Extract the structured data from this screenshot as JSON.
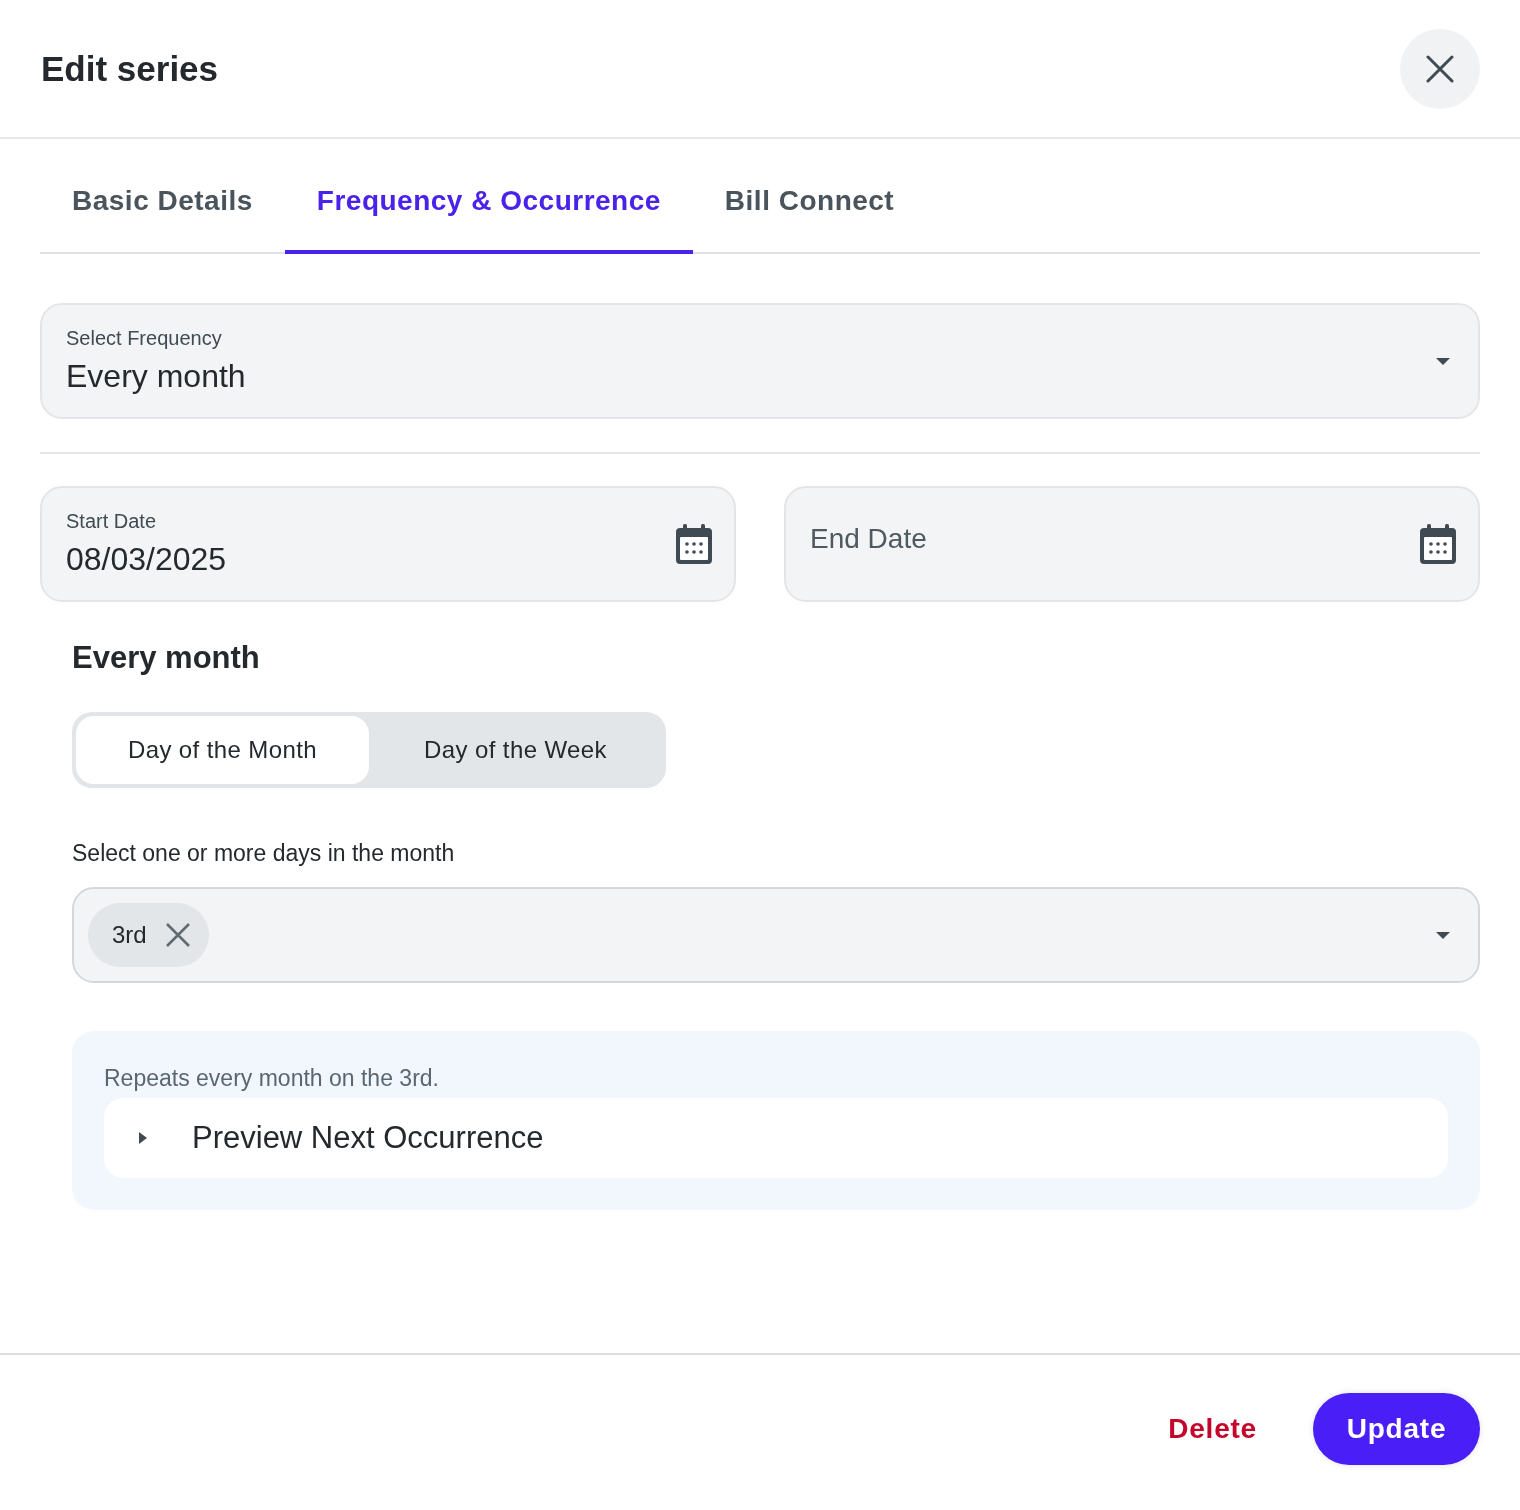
{
  "dialog": {
    "title": "Edit series"
  },
  "tabs": [
    {
      "label": "Basic Details",
      "selected": false
    },
    {
      "label": "Frequency & Occurrence",
      "selected": true
    },
    {
      "label": "Bill Connect",
      "selected": false
    }
  ],
  "frequency": {
    "label": "Select Frequency",
    "value": "Every month"
  },
  "start_date": {
    "label": "Start Date",
    "value": "08/03/2025"
  },
  "end_date": {
    "placeholder": "End Date"
  },
  "section_title": "Every month",
  "mode_options": [
    {
      "label": "Day of the Month",
      "selected": true
    },
    {
      "label": "Day of the Week",
      "selected": false
    }
  ],
  "days": {
    "label": "Select one or more days in the month",
    "chips": [
      "3rd"
    ]
  },
  "summary": {
    "text": "Repeats every month on the 3rd.",
    "preview": {
      "label": "Preview Next Occurrence",
      "expanded": false
    }
  },
  "buttons": [
    {
      "label": "Delete",
      "kind": "danger"
    },
    {
      "label": "Update",
      "kind": "primary"
    }
  ]
}
